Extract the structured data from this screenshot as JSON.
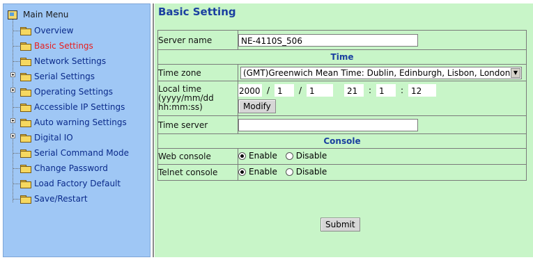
{
  "sidebar": {
    "root_label": "Main Menu",
    "items": [
      {
        "label": "Overview",
        "expandable": false,
        "active": false
      },
      {
        "label": "Basic Settings",
        "expandable": false,
        "active": true
      },
      {
        "label": "Network Settings",
        "expandable": false,
        "active": false
      },
      {
        "label": "Serial Settings",
        "expandable": true,
        "active": false
      },
      {
        "label": "Operating Settings",
        "expandable": true,
        "active": false
      },
      {
        "label": "Accessible IP Settings",
        "expandable": false,
        "active": false
      },
      {
        "label": "Auto warning Settings",
        "expandable": true,
        "active": false
      },
      {
        "label": "Digital IO",
        "expandable": true,
        "active": false
      },
      {
        "label": "Serial Command Mode",
        "expandable": false,
        "active": false
      },
      {
        "label": "Change Password",
        "expandable": false,
        "active": false
      },
      {
        "label": "Load Factory Default",
        "expandable": false,
        "active": false
      },
      {
        "label": "Save/Restart",
        "expandable": false,
        "active": false
      }
    ]
  },
  "page": {
    "title": "Basic Setting"
  },
  "form": {
    "server_name_label": "Server name",
    "server_name_value": "NE-4110S_506",
    "time_section": "Time",
    "time_zone_label": "Time zone",
    "time_zone_value": "(GMT)Greenwich Mean Time: Dublin, Edinburgh, Lisbon, London",
    "local_time_label_1": "Local time",
    "local_time_label_2": "(yyyy/mm/dd",
    "local_time_label_3": "hh:mm:ss)",
    "local_time": {
      "year": "2000",
      "month": "1",
      "day": "1",
      "hour": "21",
      "minute": "1",
      "second": "12"
    },
    "date_sep": "/",
    "time_sep": ":",
    "modify_label": "Modify",
    "time_server_label": "Time server",
    "time_server_value": "",
    "console_section": "Console",
    "web_console_label": "Web console",
    "telnet_console_label": "Telnet console",
    "enable_label": "Enable",
    "disable_label": "Disable",
    "web_console_selected": "Enable",
    "telnet_console_selected": "Enable",
    "submit_label": "Submit"
  },
  "colors": {
    "sidebar_bg": "#9fc7f5",
    "content_bg": "#c8f5c8",
    "title_color": "#1a3fa0",
    "active_menu": "#e81e1e",
    "menu_text": "#0a2a8a"
  }
}
